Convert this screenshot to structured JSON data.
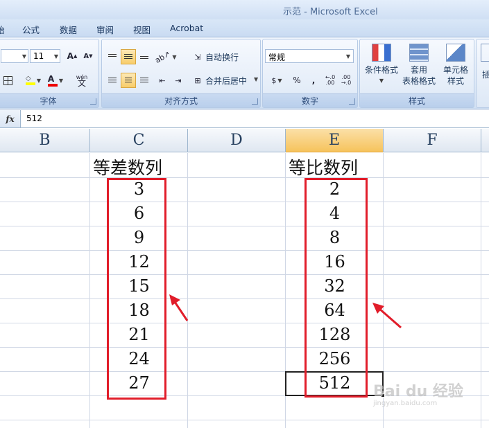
{
  "window": {
    "title": "示范 - Microsoft Excel"
  },
  "tabs": [
    "始",
    "公式",
    "数据",
    "审阅",
    "视图",
    "Acrobat"
  ],
  "ribbon": {
    "font": {
      "size": "11",
      "label": "字体"
    },
    "alignment": {
      "wrap_text": "自动换行",
      "merge_center": "合并后居中",
      "label": "对齐方式"
    },
    "number": {
      "format": "常规",
      "percent": "%",
      "comma": ",",
      "label": "数字"
    },
    "styles": {
      "conditional": "条件格式",
      "table_line1": "套用",
      "table_line2": "表格格式",
      "cell_line1": "单元格",
      "cell_line2": "样式",
      "label": "样式"
    },
    "insert_partial": "插"
  },
  "formula_bar": {
    "fx": "fx",
    "value": "512"
  },
  "columns": [
    "B",
    "C",
    "D",
    "E",
    "F"
  ],
  "selected_column": "E",
  "sheet": {
    "arithmetic_header": "等差数列",
    "arithmetic": [
      "3",
      "6",
      "9",
      "12",
      "15",
      "18",
      "21",
      "24",
      "27"
    ],
    "geometric_header": "等比数列",
    "geometric": [
      "2",
      "4",
      "8",
      "16",
      "32",
      "64",
      "128",
      "256",
      "512"
    ]
  },
  "watermark": {
    "brand": "Bai du 经验",
    "url": "jingyan.baidu.com"
  },
  "colors": {
    "highlight_box": "#e11d2a",
    "selected_header": "#f6c35c"
  }
}
